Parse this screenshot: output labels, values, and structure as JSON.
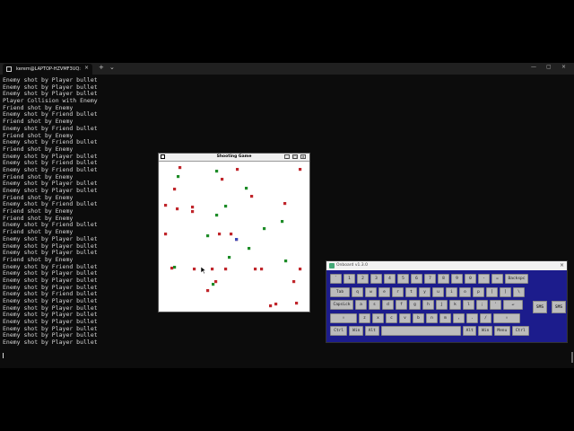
{
  "terminal": {
    "tab_title": "kerem@LAPTOP-HZVMF3UQ:",
    "new_tab_label": "+",
    "dropdown_label": "⌄",
    "tab_close_label": "×",
    "window_controls": [
      "—",
      "▢",
      "×"
    ],
    "lines": [
      "Enemy shot by Player bullet",
      "Enemy shot by Player bullet",
      "Enemy shot by Player bullet",
      "Player Collision with Enemy",
      "Friend shot by Enemy",
      "Enemy shot by Friend bullet",
      "Friend shot by Enemy",
      "Enemy shot by Friend bullet",
      "Friend shot by Enemy",
      "Enemy shot by Friend bullet",
      "Friend shot by Enemy",
      "Enemy shot by Player bullet",
      "Enemy shot by Friend bullet",
      "Enemy shot by Friend bullet",
      "Friend shot by Enemy",
      "Enemy shot by Player bullet",
      "Enemy shot by Player bullet",
      "Friend shot by Enemy",
      "Enemy shot by Friend bullet",
      "Friend shot by Enemy",
      "Friend shot by Enemy",
      "Enemy shot by Friend bullet",
      "Friend shot by Enemy",
      "Enemy shot by Player bullet",
      "Enemy shot by Player bullet",
      "Enemy shot by Player bullet",
      "Friend shot by Enemy",
      "Enemy shot by Friend bullet",
      "Enemy shot by Player bullet",
      "Enemy shot by Player bullet",
      "Enemy shot by Player bullet",
      "Enemy shot by Friend bullet",
      "Enemy shot by Player bullet",
      "Enemy shot by Player bullet",
      "Enemy shot by Player bullet",
      "Enemy shot by Player bullet",
      "Enemy shot by Player bullet",
      "Enemy shot by Player bullet",
      "Enemy shot by Player bullet"
    ]
  },
  "game": {
    "title": "Shooting Game",
    "controls": [
      "_",
      "□",
      "×"
    ],
    "colors": {
      "enemy": "#c0262c",
      "friend": "#1e8c28",
      "player": "#3a4ab8",
      "background": "#ffffff"
    }
  },
  "onboard": {
    "title": "Onboard v1.3.0",
    "close_label": "×",
    "rows": [
      [
        "`",
        "1",
        "2",
        "3",
        "4",
        "5",
        "6",
        "7",
        "8",
        "9",
        "0",
        "-",
        "=",
        "Backspc"
      ],
      [
        "Tab",
        "q",
        "w",
        "e",
        "r",
        "t",
        "y",
        "u",
        "i",
        "o",
        "p",
        "[",
        "]",
        "\\"
      ],
      [
        "CapsLck",
        "a",
        "s",
        "d",
        "f",
        "g",
        "h",
        "j",
        "k",
        "l",
        ";",
        "'",
        "↵"
      ],
      [
        "⇧",
        "z",
        "x",
        "c",
        "v",
        "b",
        "n",
        "m",
        ",",
        ".",
        "/",
        "⇧"
      ],
      [
        "Ctrl",
        "Win",
        "Alt",
        "",
        "Alt",
        "Win",
        "Menu",
        "Ctrl"
      ]
    ],
    "side_keys": [
      "SMS",
      "SMS"
    ],
    "colors": {
      "background": "#1c1c8c",
      "key": "#bcbcbc"
    }
  }
}
